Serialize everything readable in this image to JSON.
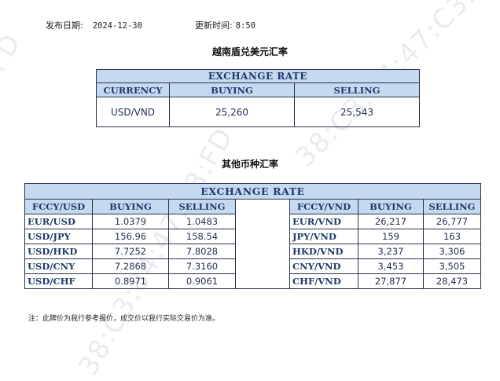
{
  "header": {
    "release_date_label": "发布日期:",
    "release_date": "2024-12-30",
    "update_time_label": "更新时间:",
    "update_time": "8:50"
  },
  "section1": {
    "title": "越南盾兑美元汇率",
    "band": "EXCHANGE RATE",
    "col_currency": "CURRENCY",
    "col_buying": "BUYING",
    "col_selling": "SELLING",
    "row": {
      "currency": "USD/VND",
      "buying": "25,260",
      "selling": "25,543"
    }
  },
  "section2": {
    "title": "其他币种汇率",
    "band": "EXCHANGE  RATE",
    "left_headers": [
      "FCCY/USD",
      "BUYING",
      "SELLING"
    ],
    "right_headers": [
      "FCCY/VND",
      "BUYING",
      "SELLING"
    ],
    "left_rows": [
      {
        "pair": "EUR/USD",
        "buying": "1.0379",
        "selling": "1.0483"
      },
      {
        "pair": "USD/JPY",
        "buying": "156.96",
        "selling": "158.54"
      },
      {
        "pair": "USD/HKD",
        "buying": "7.7252",
        "selling": "7.8028"
      },
      {
        "pair": "USD/CNY",
        "buying": "7.2868",
        "selling": "7.3160"
      },
      {
        "pair": "USD/CHF",
        "buying": "0.8971",
        "selling": "0.9061"
      }
    ],
    "right_rows": [
      {
        "pair": "EUR/VND",
        "buying": "26,217",
        "selling": "26,777"
      },
      {
        "pair": "JPY/VND",
        "buying": "159",
        "selling": "163"
      },
      {
        "pair": "HKD/VND",
        "buying": "3,237",
        "selling": "3,306"
      },
      {
        "pair": "CNY/VND",
        "buying": "3,453",
        "selling": "3,505"
      },
      {
        "pair": "CHF/VND",
        "buying": "27,877",
        "selling": "28,473"
      }
    ]
  },
  "note": "注：此牌价为我行参考报价，成交价以我行实际交易价为准。",
  "watermark": "38:C3:84:47:C3:FD",
  "colors": {
    "header_fill": "#c5d9f1",
    "header_text": "#1f3a6b",
    "border": "#2b3245"
  }
}
